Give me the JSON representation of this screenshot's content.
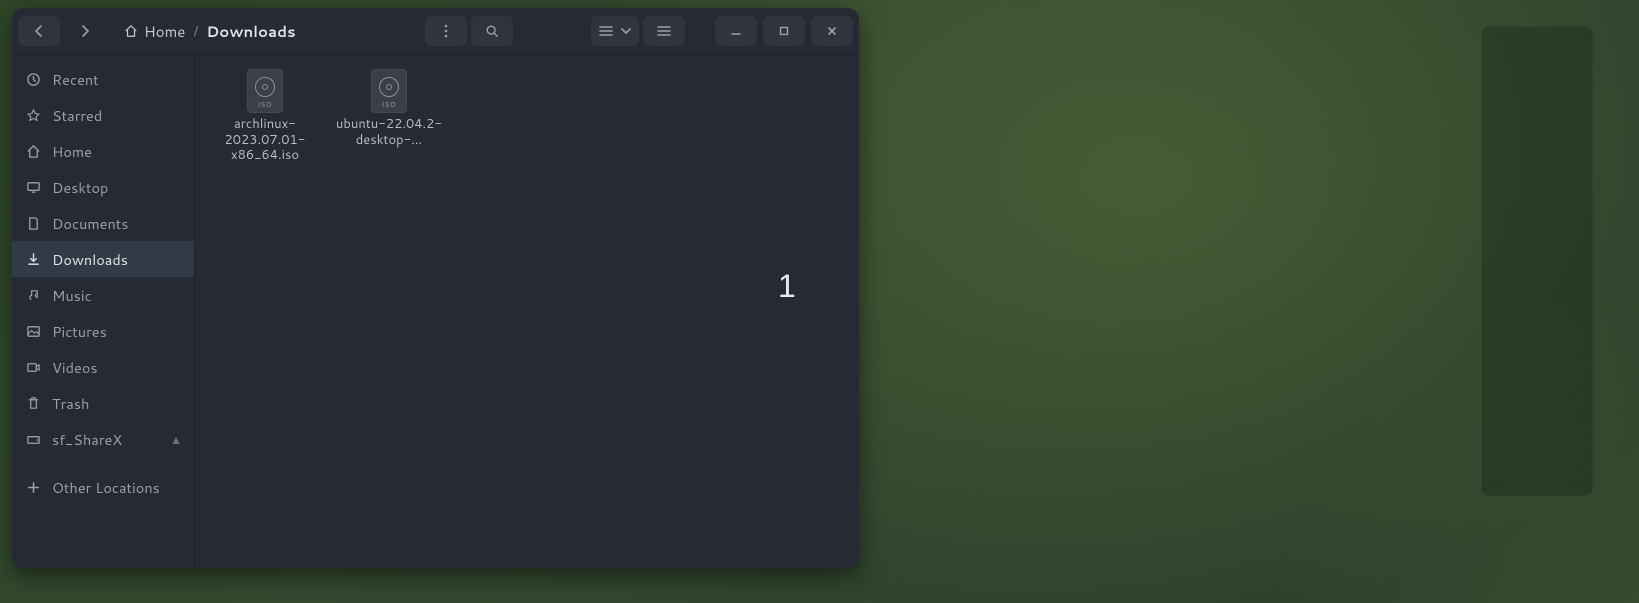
{
  "breadcrumb": {
    "home": "Home",
    "current": "Downloads"
  },
  "sidebar": {
    "items": [
      {
        "icon": "clock-icon",
        "label": "Recent"
      },
      {
        "icon": "star-icon",
        "label": "Starred"
      },
      {
        "icon": "home-icon",
        "label": "Home"
      },
      {
        "icon": "desktop-icon",
        "label": "Desktop"
      },
      {
        "icon": "document-icon",
        "label": "Documents"
      },
      {
        "icon": "download-icon",
        "label": "Downloads",
        "selected": true
      },
      {
        "icon": "music-icon",
        "label": "Music"
      },
      {
        "icon": "image-icon",
        "label": "Pictures"
      },
      {
        "icon": "video-icon",
        "label": "Videos"
      },
      {
        "icon": "trash-icon",
        "label": "Trash"
      },
      {
        "icon": "drive-icon",
        "label": "sf_ShareX",
        "ejectable": true
      }
    ],
    "bottom": {
      "icon": "plus-icon",
      "label": "Other Locations"
    }
  },
  "files": [
    {
      "name": "archlinux-2023.07.01-x86_64.iso",
      "type": "iso"
    },
    {
      "name": "ubuntu-22.04.2-desktop-…",
      "type": "iso"
    }
  ],
  "overlay": {
    "text": "1"
  }
}
